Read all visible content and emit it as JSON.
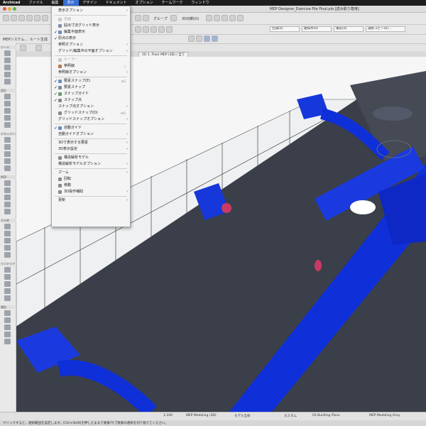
{
  "menubar": {
    "app": "Archicad",
    "items": [
      "ファイル",
      "編集",
      "表示",
      "デザイン",
      "ドキュメント",
      "オプション",
      "チームワーク",
      "ウィンドウ"
    ],
    "active_index": 2
  },
  "window": {
    "title": "MEP Designer_Exercise File Final.pla [読み取り専用]"
  },
  "toolbar": {
    "layer_label": "グループ",
    "view_mode": "3D切断(0)",
    "mep_label": "MEPシステム...",
    "route_label": "ルート生成",
    "dropdowns": [
      "空調(0)",
      "給排水(0)",
      "電気(0)",
      "選択コピー(0)..."
    ]
  },
  "viewport": {
    "tab_label": "(0) 1. Floor MEP (3D) / 全て",
    "accent_pipe": "#0f2fd8",
    "floor_color": "#3b3f4a"
  },
  "toolbox": {
    "sections": [
      "ツール",
      "設計",
      "ドキュメント",
      "MEP",
      "その他",
      "インテリア",
      "構造"
    ]
  },
  "menu": {
    "items": [
      {
        "label": "表示オプション",
        "arrow": true,
        "check": false,
        "icon": false,
        "disabled": false
      },
      {
        "sep": true
      },
      {
        "label": "全画",
        "icon": true,
        "icon_color": "#c9c9c9",
        "disabled": true,
        "check": false,
        "arrow": false
      },
      {
        "label": "貼出寸法グリッド表示",
        "icon": true,
        "icon_color": "#7f8fa8",
        "check": false,
        "arrow": false,
        "disabled": false
      },
      {
        "label": "編集平面表示",
        "icon": true,
        "icon_color": "#6c8cc5",
        "check": true,
        "arrow": false,
        "disabled": false
      },
      {
        "label": "原点の表示",
        "icon": false,
        "check": true,
        "arrow": false,
        "disabled": false
      },
      {
        "label": "参照オプション",
        "icon": false,
        "check": false,
        "arrow": true,
        "disabled": false
      },
      {
        "label": "グリッド/編集中の平面オプション",
        "icon": false,
        "check": false,
        "arrow": true,
        "disabled": false
      },
      {
        "sep": true
      },
      {
        "label": "ルーラー",
        "icon": true,
        "icon_color": "#c9c9c9",
        "disabled": true,
        "check": false,
        "arrow": false
      },
      {
        "label": "参照線",
        "icon": true,
        "icon_color": "#b77b4f",
        "check": false,
        "arrow": false,
        "disabled": false,
        "shortcut": "L"
      },
      {
        "label": "参照線オプション",
        "icon": false,
        "check": false,
        "arrow": true,
        "disabled": false
      },
      {
        "sep": true
      },
      {
        "label": "要素スナップ(E)",
        "icon": true,
        "icon_color": "#6b8fc4",
        "check": true,
        "arrow": false,
        "disabled": false,
        "shortcut": "⌘E"
      },
      {
        "label": "要素スナップ",
        "icon": true,
        "icon_color": "#7d8aa0",
        "check": true,
        "arrow": false,
        "disabled": false
      },
      {
        "label": "スナップガイド",
        "icon": true,
        "icon_color": "#6f9a6f",
        "check": true,
        "arrow": false,
        "disabled": false
      },
      {
        "label": "スナップ点",
        "icon": true,
        "icon_color": "#8a8a8a",
        "check": true,
        "arrow": false,
        "disabled": false
      },
      {
        "label": "スナップ点オプション",
        "icon": false,
        "check": false,
        "arrow": true,
        "disabled": false
      },
      {
        "label": "グリッドスナップ(D)",
        "icon": true,
        "icon_color": "#8a8a8a",
        "check": false,
        "arrow": false,
        "disabled": false,
        "shortcut": "⌘D"
      },
      {
        "label": "グリッドスナップオプション",
        "icon": false,
        "check": false,
        "arrow": true,
        "disabled": false
      },
      {
        "sep": true
      },
      {
        "label": "自動ガイド",
        "icon": true,
        "icon_color": "#5f8fd0",
        "check": true,
        "arrow": false,
        "disabled": false
      },
      {
        "label": "自動ガイドオプション",
        "icon": false,
        "check": false,
        "arrow": true,
        "disabled": false
      },
      {
        "sep": true
      },
      {
        "label": "3Dで表示する要素",
        "icon": false,
        "check": false,
        "arrow": true,
        "disabled": false
      },
      {
        "label": "3D表示設定",
        "icon": false,
        "check": false,
        "arrow": true,
        "disabled": false
      },
      {
        "sep": true
      },
      {
        "label": "構造解析モデル",
        "icon": true,
        "icon_color": "#8a8a8a",
        "check": false,
        "arrow": false,
        "disabled": false
      },
      {
        "label": "構造解析モデルオプション",
        "icon": false,
        "check": false,
        "arrow": true,
        "disabled": false
      },
      {
        "sep": true
      },
      {
        "label": "ズーム",
        "icon": false,
        "check": false,
        "arrow": true,
        "disabled": false
      },
      {
        "label": "回転",
        "icon": true,
        "icon_color": "#8a8a8a",
        "check": false,
        "arrow": false,
        "disabled": false
      },
      {
        "label": "移動",
        "icon": true,
        "icon_color": "#8a8a8a",
        "check": false,
        "arrow": false,
        "disabled": false
      },
      {
        "label": "3D操作補助",
        "icon": true,
        "icon_color": "#8a8a8a",
        "check": false,
        "arrow": true,
        "disabled": false
      },
      {
        "sep": true
      },
      {
        "label": "更新",
        "icon": false,
        "check": false,
        "arrow": true,
        "disabled": false
      }
    ]
  },
  "statusbar": {
    "scale": "1:100",
    "model_view": "MEP Modeling (3D)",
    "layers": "モデル全体",
    "pen_set": "カスタム",
    "structure": "03 Building Plans",
    "graphic_override": "MEP Modeling Grey",
    "hint": "クリックすると、選択範囲を設定します。[Ctrl+Shift]を押したままで要素/サブ要素の選択を切り替えてください。"
  }
}
